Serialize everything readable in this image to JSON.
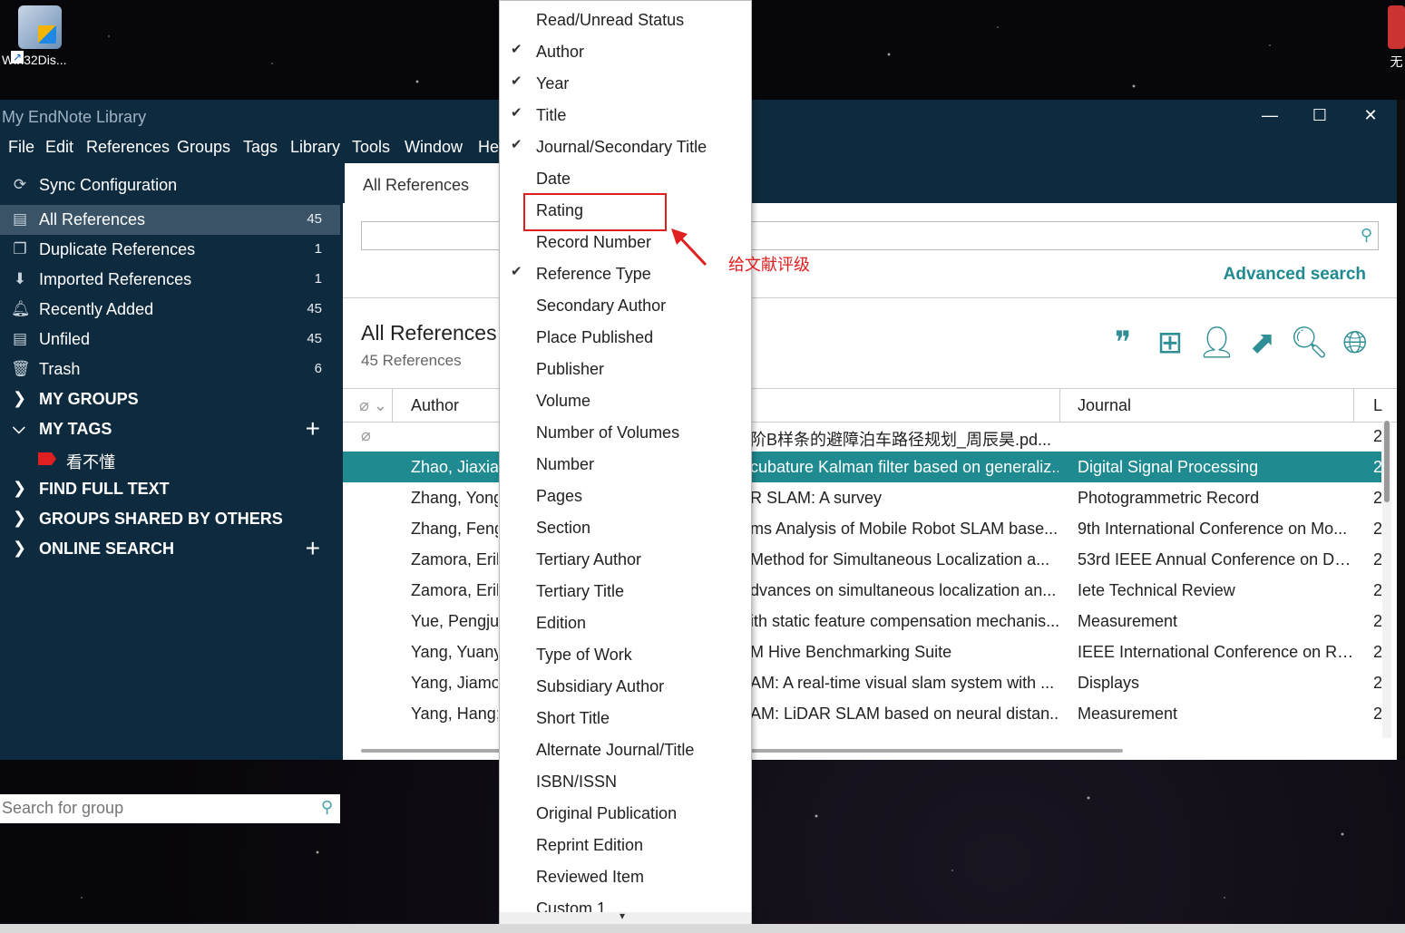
{
  "desktop": {
    "icon_left_label": "Win32Dis...",
    "icon_right_label": "无"
  },
  "window": {
    "title": "My EndNote Library",
    "minimize": "—",
    "maximize": "☐",
    "close": "✕"
  },
  "menu": [
    "File",
    "Edit",
    "References",
    "Groups",
    "Tags",
    "Library",
    "Tools",
    "Window",
    "He"
  ],
  "sidebar": {
    "sync": "Sync Configuration",
    "items": [
      {
        "label": "All References",
        "count": "45"
      },
      {
        "label": "Duplicate References",
        "count": "1"
      },
      {
        "label": "Imported References",
        "count": "1"
      },
      {
        "label": "Recently Added",
        "count": "45"
      },
      {
        "label": "Unfiled",
        "count": "45"
      },
      {
        "label": "Trash",
        "count": "6"
      }
    ],
    "sections": {
      "my_groups": "MY GROUPS",
      "my_tags": "MY TAGS",
      "tag1": "看不懂",
      "find_full_text": "FIND FULL TEXT",
      "groups_shared": "GROUPS SHARED BY OTHERS",
      "online_search": "ONLINE SEARCH"
    },
    "search_placeholder": "Search for group"
  },
  "main": {
    "tab": "All References",
    "advanced_search": "Advanced search",
    "lib_title": "All References",
    "lib_count": "45 References",
    "columns": {
      "author": "Author",
      "journal": "Journal",
      "last": "L"
    },
    "rows": [
      {
        "author": "",
        "title": "阶B样条的避障泊车路径规划_周辰昊.pd...",
        "journal": "",
        "last": "2"
      },
      {
        "author": "Zhao, Jiaxian",
        "title": "cubature Kalman filter based on generaliz...",
        "journal": "Digital Signal Processing",
        "last": "2"
      },
      {
        "author": "Zhang, Yong",
        "title": "R SLAM: A survey",
        "journal": "Photogrammetric Record",
        "last": "2"
      },
      {
        "author": "Zhang, Feng",
        "title": "ms Analysis of Mobile Robot SLAM base...",
        "journal": "9th International Conference on Mo...",
        "last": "2"
      },
      {
        "author": "Zamora, Erik",
        "title": "Method for Simultaneous Localization a...",
        "journal": "53rd IEEE Annual Conference on Dec...",
        "last": "2"
      },
      {
        "author": "Zamora, Erik",
        "title": "dvances on simultaneous localization an...",
        "journal": "Iete Technical Review",
        "last": "2"
      },
      {
        "author": "Yue, Pengju;",
        "title": "ith static feature compensation mechanis...",
        "journal": "Measurement",
        "last": "2"
      },
      {
        "author": "Yang, Yuany",
        "title": "M Hive Benchmarking Suite",
        "journal": "IEEE International Conference on Ro...",
        "last": "2"
      },
      {
        "author": "Yang, Jiamou",
        "title": "AM: A real-time visual slam system with ...",
        "journal": "Displays",
        "last": "2"
      },
      {
        "author": "Yang, Hang;",
        "title": "AM: LiDAR SLAM based on neural distan...",
        "journal": "Measurement",
        "last": "2"
      }
    ]
  },
  "context_menu": {
    "items": [
      {
        "label": "Read/Unread Status",
        "checked": false
      },
      {
        "label": "Author",
        "checked": true
      },
      {
        "label": "Year",
        "checked": true
      },
      {
        "label": "Title",
        "checked": true
      },
      {
        "label": "Journal/Secondary Title",
        "checked": true
      },
      {
        "label": "Date",
        "checked": false
      },
      {
        "label": "Rating",
        "checked": false
      },
      {
        "label": "Record Number",
        "checked": false
      },
      {
        "label": "Reference Type",
        "checked": true
      },
      {
        "label": "Secondary Author",
        "checked": false
      },
      {
        "label": "Place Published",
        "checked": false
      },
      {
        "label": "Publisher",
        "checked": false
      },
      {
        "label": "Volume",
        "checked": false
      },
      {
        "label": "Number of Volumes",
        "checked": false
      },
      {
        "label": "Number",
        "checked": false
      },
      {
        "label": "Pages",
        "checked": false
      },
      {
        "label": "Section",
        "checked": false
      },
      {
        "label": "Tertiary Author",
        "checked": false
      },
      {
        "label": "Tertiary Title",
        "checked": false
      },
      {
        "label": "Edition",
        "checked": false
      },
      {
        "label": "Type of Work",
        "checked": false
      },
      {
        "label": "Subsidiary Author",
        "checked": false
      },
      {
        "label": "Short Title",
        "checked": false
      },
      {
        "label": "Alternate Journal/Title",
        "checked": false
      },
      {
        "label": "ISBN/ISSN",
        "checked": false
      },
      {
        "label": "Original Publication",
        "checked": false
      },
      {
        "label": "Reprint Edition",
        "checked": false
      },
      {
        "label": "Reviewed Item",
        "checked": false
      },
      {
        "label": "Custom 1",
        "checked": false
      }
    ]
  },
  "annotation": {
    "text": "给文献评级",
    "color": "#e02020"
  },
  "colors": {
    "sidebar_bg": "#0e2a3e",
    "selected_row": "#1f8a90",
    "accent": "#1f8a90"
  }
}
